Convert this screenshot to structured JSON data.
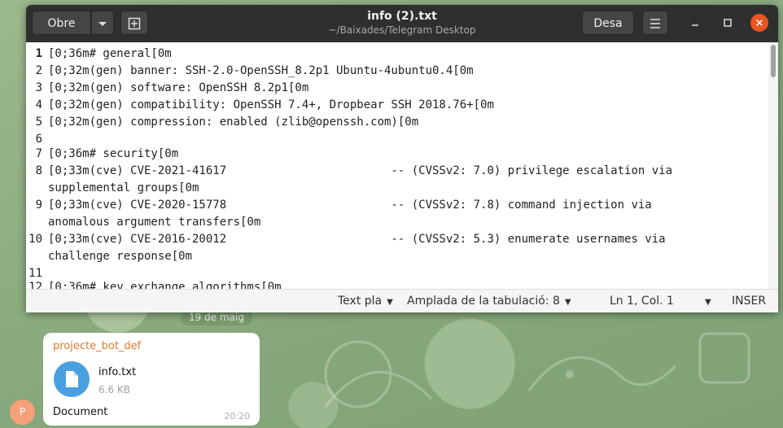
{
  "window": {
    "title": "info (2).txt",
    "subtitle": "~/Baixades/Telegram Desktop",
    "open_label": "Obre",
    "save_label": "Desa"
  },
  "editor": {
    "lines": [
      {
        "num": "1",
        "text": "[0;36m# general[0m"
      },
      {
        "num": "2",
        "text": "[0;32m(gen) banner: SSH-2.0-OpenSSH_8.2p1 Ubuntu-4ubuntu0.4[0m"
      },
      {
        "num": "3",
        "text": "[0;32m(gen) software: OpenSSH 8.2p1[0m"
      },
      {
        "num": "4",
        "text": "[0;32m(gen) compatibility: OpenSSH 7.4+, Dropbear SSH 2018.76+[0m"
      },
      {
        "num": "5",
        "text": "[0;32m(gen) compression: enabled (zlib@openssh.com)[0m"
      },
      {
        "num": "6",
        "text": ""
      },
      {
        "num": "7",
        "text": "[0;36m# security[0m"
      },
      {
        "num": "8",
        "text": "[0;33m(cve) CVE-2021-41617                        -- (CVSSv2: 7.0) privilege escalation via"
      },
      {
        "num": "",
        "text": "supplemental groups[0m"
      },
      {
        "num": "9",
        "text": "[0;33m(cve) CVE-2020-15778                        -- (CVSSv2: 7.8) command injection via"
      },
      {
        "num": "",
        "text": "anomalous argument transfers[0m"
      },
      {
        "num": "10",
        "text": "[0;33m(cve) CVE-2016-20012                        -- (CVSSv2: 5.3) enumerate usernames via"
      },
      {
        "num": "",
        "text": "challenge response[0m"
      },
      {
        "num": "11",
        "text": ""
      },
      {
        "num": "12",
        "text": "[0;36m# key exchange algorithms[0m"
      }
    ]
  },
  "statusbar": {
    "syntax": "Text pla",
    "tab_width": "Amplada de la tabulació: 8",
    "position": "Ln 1, Col. 1",
    "mode": "INSER"
  },
  "telegram": {
    "date": "19 de maig",
    "sender": "projecte_bot_def",
    "file_name": "info.txt",
    "file_size": "6.6 KB",
    "caption": "Document",
    "time": "20:20",
    "avatar_letter": "P"
  }
}
